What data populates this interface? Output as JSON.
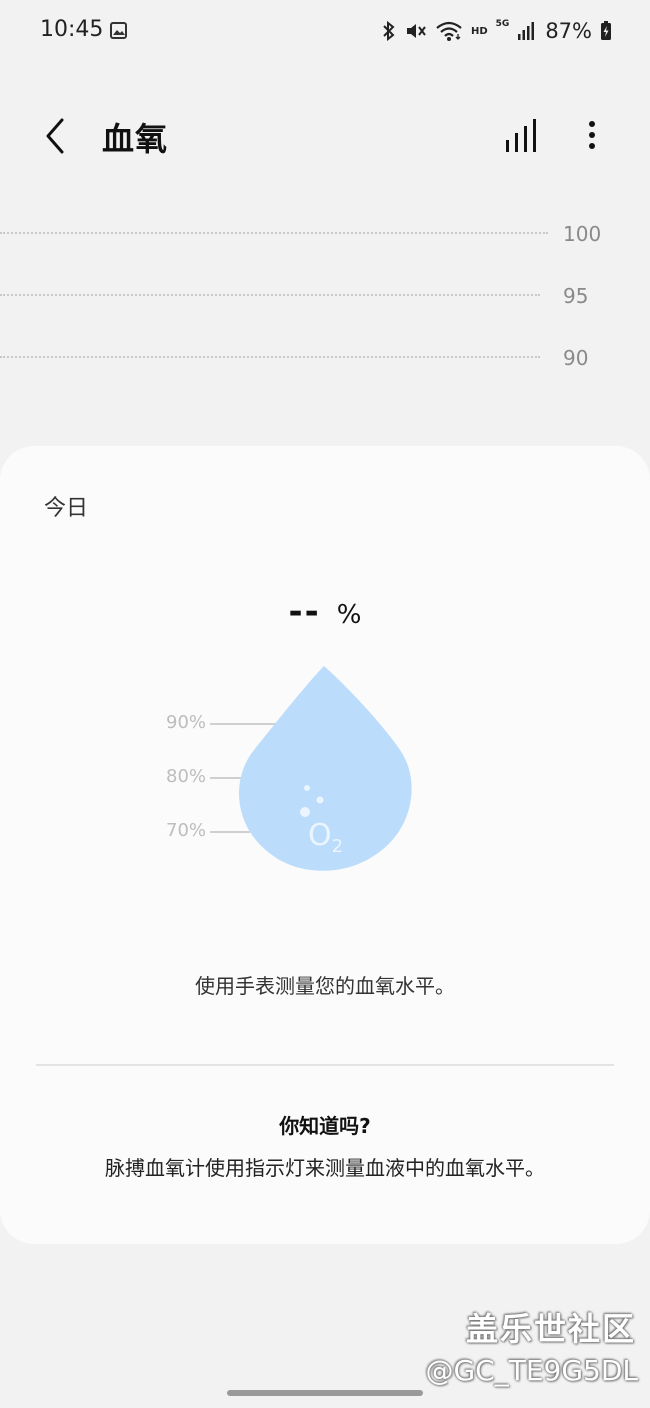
{
  "status_bar": {
    "time": "10:45",
    "hd": "HD",
    "network": "5G",
    "battery": "87%",
    "icons": [
      "gallery-icon",
      "bluetooth-icon",
      "mute-icon",
      "wifi-icon",
      "signal-icon",
      "battery-charging-icon"
    ]
  },
  "header": {
    "title": "血氧",
    "icons": [
      "back-arrow-icon",
      "trends-bars-icon",
      "more-vert-icon"
    ]
  },
  "chart": {
    "gridlines": [
      "100",
      "95",
      "90"
    ]
  },
  "today_card": {
    "heading": "今日",
    "value": "--",
    "unit": "%",
    "scale_labels": [
      "90%",
      "80%",
      "70%"
    ],
    "drop_label": "O",
    "drop_sub": "2",
    "instruction": "使用手表测量您的血氧水平。",
    "tip_title": "你知道吗?",
    "tip_body": "脉搏血氧计使用指示灯来测量血液中的血氧水平。"
  },
  "watermark": {
    "title": "盖乐世社区",
    "user": "@GC_TE9G5DL"
  },
  "colors": {
    "background": "#f2f2f2",
    "card": "#fbfbfb",
    "drop": "#bcdcfc",
    "drop_accent": "#eaf5ff"
  }
}
